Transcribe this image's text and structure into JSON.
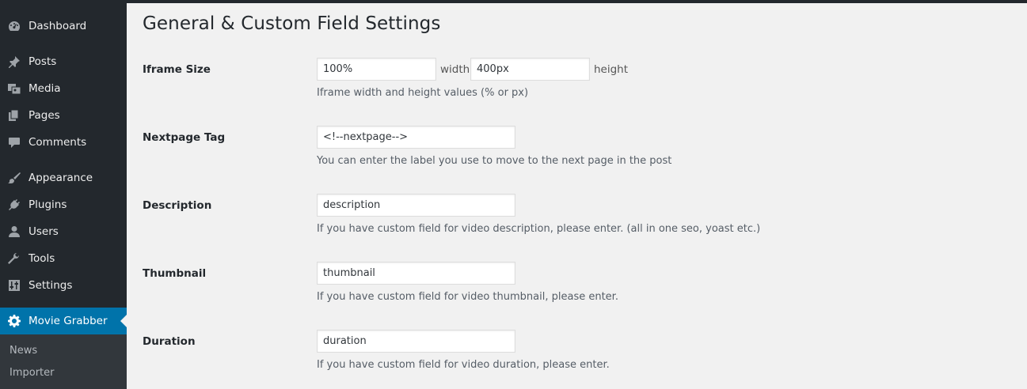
{
  "sidebar": {
    "items": [
      {
        "label": "Dashboard",
        "icon": "dashboard-icon"
      },
      {
        "label": "Posts",
        "icon": "pin-icon"
      },
      {
        "label": "Media",
        "icon": "media-icon"
      },
      {
        "label": "Pages",
        "icon": "pages-icon"
      },
      {
        "label": "Comments",
        "icon": "comment-icon"
      },
      {
        "label": "Appearance",
        "icon": "brush-icon"
      },
      {
        "label": "Plugins",
        "icon": "plug-icon"
      },
      {
        "label": "Users",
        "icon": "user-icon"
      },
      {
        "label": "Tools",
        "icon": "wrench-icon"
      },
      {
        "label": "Settings",
        "icon": "settings-sliders-icon"
      },
      {
        "label": "Movie Grabber",
        "icon": "gear-icon",
        "active": true
      }
    ],
    "submenu": [
      {
        "label": "News"
      },
      {
        "label": "Importer"
      }
    ]
  },
  "main": {
    "title": "General & Custom Field Settings",
    "rows": [
      {
        "label": "Iframe Size",
        "width_value": "100%",
        "width_unit": "width",
        "height_value": "400px",
        "height_unit": "height",
        "description": "Iframe width and height values (% or px)"
      },
      {
        "label": "Nextpage Tag",
        "value": "<!--nextpage-->",
        "description": "You can enter the label you use to move to the next page in the post"
      },
      {
        "label": "Description",
        "value": "description",
        "description": "If you have custom field for video description, please enter. (all in one seo, yoast etc.)"
      },
      {
        "label": "Thumbnail",
        "value": "thumbnail",
        "description": "If you have custom field for video thumbnail, please enter."
      },
      {
        "label": "Duration",
        "value": "duration",
        "description": "If you have custom field for video duration, please enter."
      }
    ]
  },
  "colors": {
    "sidebar_bg": "#23282d",
    "active_bg": "#0073aa",
    "submenu_bg": "#32373c",
    "content_bg": "#f1f1f1"
  }
}
